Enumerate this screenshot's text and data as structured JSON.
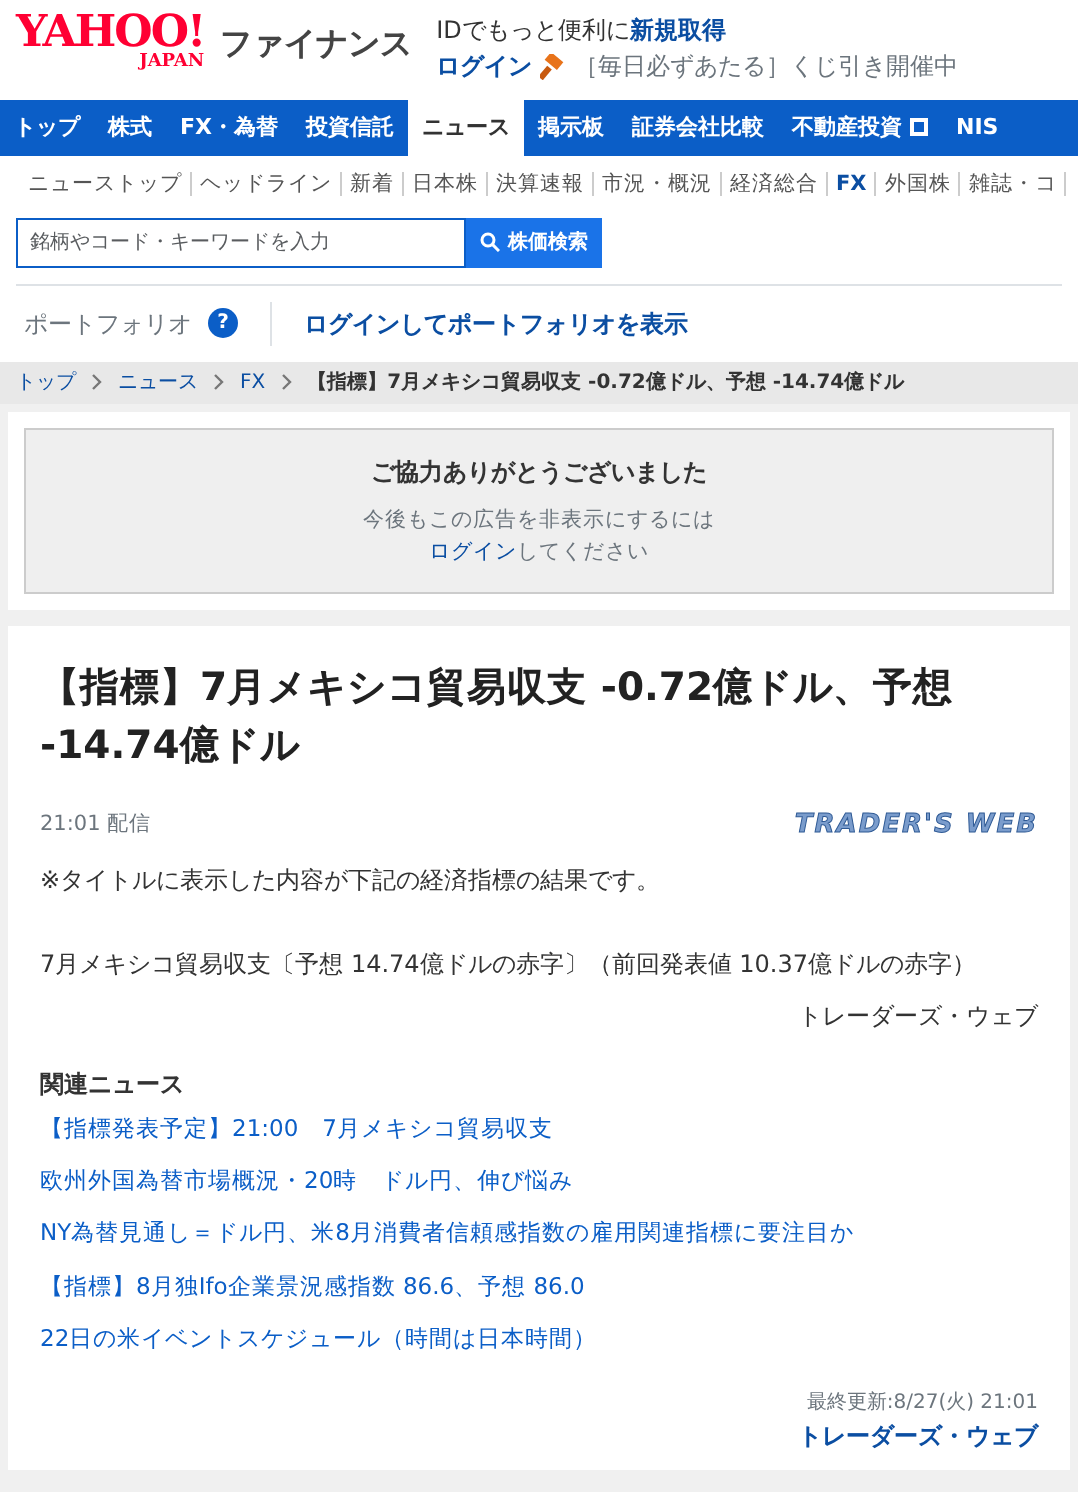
{
  "header": {
    "logo": "YAHOO!",
    "logo_sub": "JAPAN",
    "brand": "ファイナンス",
    "promo_prefix": "IDでもっと便利に",
    "promo_link": "新規取得",
    "login": "ログイン",
    "lottery": "［毎日必ずあたる］くじ引き開催中"
  },
  "nav": [
    {
      "label": "トップ",
      "selected": false
    },
    {
      "label": "株式",
      "selected": false
    },
    {
      "label": "FX・為替",
      "selected": false
    },
    {
      "label": "投資信託",
      "selected": false
    },
    {
      "label": "ニュース",
      "selected": true
    },
    {
      "label": "掲示板",
      "selected": false
    },
    {
      "label": "証券会社比較",
      "selected": false
    },
    {
      "label": "不動産投資",
      "selected": false,
      "external": true
    },
    {
      "label": "NIS",
      "selected": false
    }
  ],
  "subnav": [
    {
      "label": "ニューストップ",
      "selected": false
    },
    {
      "label": "ヘッドライン",
      "selected": false
    },
    {
      "label": "新着",
      "selected": false
    },
    {
      "label": "日本株",
      "selected": false
    },
    {
      "label": "決算速報",
      "selected": false
    },
    {
      "label": "市況・概況",
      "selected": false
    },
    {
      "label": "経済総合",
      "selected": false
    },
    {
      "label": "FX",
      "selected": true
    },
    {
      "label": "外国株",
      "selected": false
    },
    {
      "label": "雑誌・コ",
      "selected": false
    }
  ],
  "search": {
    "placeholder": "銘柄やコード・キーワードを入力",
    "button": "株価検索"
  },
  "portfolio": {
    "label": "ポートフォリオ",
    "help": "?",
    "link": "ログインしてポートフォリオを表示"
  },
  "breadcrumb": [
    "トップ",
    "ニュース",
    "FX"
  ],
  "breadcrumb_current": "【指標】7月メキシコ貿易収支 -0.72億ドル、予想 -14.74億ドル",
  "ad_notice": {
    "title": "ご協力ありがとうございました",
    "line": "今後もこの広告を非表示にするには",
    "login": "ログイン",
    "tail": "してください"
  },
  "article": {
    "title": "【指標】7月メキシコ貿易収支 -0.72億ドル、予想 -14.74億ドル",
    "time": "21:01 配信",
    "source_logo": "TRADER'S WEB",
    "note": "※タイトルに表示した内容が下記の経済指標の結果です。",
    "detail": "7月メキシコ貿易収支〔予想 14.74億ドルの赤字〕（前回発表値 10.37億ドルの赤字）",
    "signature": "トレーダーズ・ウェブ",
    "related_heading": "関連ニュース",
    "related": [
      "【指標発表予定】21:00　7月メキシコ貿易収支",
      "欧州外国為替市場概況・20時　ドル円、伸び悩み",
      "NY為替見通し＝ドル円、米8月消費者信頼感指数の雇用関連指標に要注目か",
      "【指標】8月独Ifo企業景況感指数 86.6、予想 86.0",
      "22日の米イベントスケジュール（時間は日本時間）"
    ],
    "updated": "最終更新:8/27(火) 21:01",
    "provider": "トレーダーズ・ウェブ"
  }
}
